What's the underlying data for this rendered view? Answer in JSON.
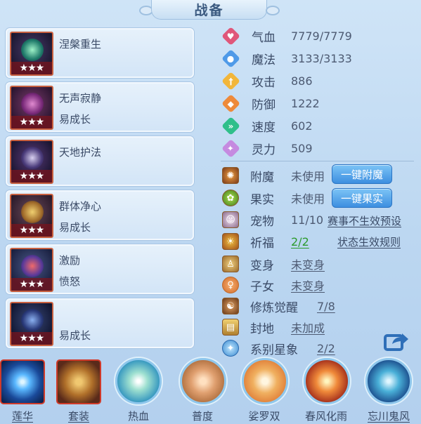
{
  "header": {
    "title": "战备"
  },
  "skills": [
    {
      "name": "涅槃重生",
      "sub": "",
      "stars": "★★★"
    },
    {
      "name": "无声寂静",
      "sub": "易成长",
      "stars": "★★★"
    },
    {
      "name": "天地护法",
      "sub": "",
      "stars": "★★★"
    },
    {
      "name": "群体净心",
      "sub": "易成长",
      "stars": "★★★"
    },
    {
      "name": "激励",
      "sub": "愤怒",
      "stars": "★★★"
    },
    {
      "name": "",
      "sub": "易成长",
      "stars": "★★★"
    }
  ],
  "stats": [
    {
      "label": "气血",
      "value": "7779/7779",
      "icon": "heart-icon",
      "color": "#e0577a"
    },
    {
      "label": "魔法",
      "value": "3133/3133",
      "icon": "mana-icon",
      "color": "#4f9ae8"
    },
    {
      "label": "攻击",
      "value": "886",
      "icon": "sword-icon",
      "color": "#f2b63a"
    },
    {
      "label": "防御",
      "value": "1222",
      "icon": "shield-icon",
      "color": "#ee8a3a"
    },
    {
      "label": "速度",
      "value": "602",
      "icon": "speed-icon",
      "color": "#2fbf8a"
    },
    {
      "label": "灵力",
      "value": "509",
      "icon": "spirit-icon",
      "color": "#c58ae0"
    }
  ],
  "extras": {
    "enchant": {
      "label": "附魔",
      "value": "未使用",
      "button": "一键附魔"
    },
    "fruit": {
      "label": "果实",
      "value": "未使用",
      "button": "一键果实"
    },
    "pet": {
      "label": "宠物",
      "value": "11/10",
      "link": "赛事不生效预设"
    },
    "blessing": {
      "label": "祈福",
      "value": "2/2",
      "link": "状态生效规则"
    },
    "transform": {
      "label": "变身",
      "value": "未变身"
    },
    "daughter": {
      "label": "子女",
      "value": "未变身"
    },
    "cultivation": {
      "label": "修炼觉醒",
      "value": "7/8"
    },
    "territory": {
      "label": "封地",
      "value": "未加成"
    },
    "constellation": {
      "label": "系别星象",
      "value": "2/2"
    }
  },
  "bottom_skills": [
    {
      "label": "莲华"
    },
    {
      "label": "套装"
    },
    {
      "label": "热血"
    },
    {
      "label": "普度"
    },
    {
      "label": "娑罗双"
    },
    {
      "label": "春风化雨"
    },
    {
      "label": "忘川鬼风"
    }
  ]
}
